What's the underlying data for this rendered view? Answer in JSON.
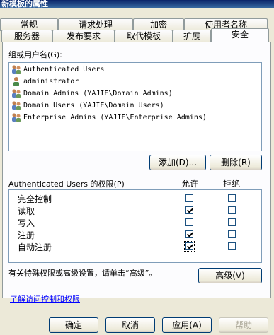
{
  "window": {
    "title": "新模板的属性"
  },
  "tabs_row1": [
    {
      "label": "常规"
    },
    {
      "label": "请求处理"
    },
    {
      "label": "加密"
    },
    {
      "label": "使用者名称"
    }
  ],
  "tabs_row2": [
    {
      "label": "服务器"
    },
    {
      "label": "发布要求"
    },
    {
      "label": "取代模板"
    },
    {
      "label": "扩展"
    },
    {
      "label": "安全"
    }
  ],
  "group": {
    "label": "组或用户名(G):",
    "items": [
      {
        "label": "Authenticated Users",
        "icon": "group-icon"
      },
      {
        "label": "administrator",
        "icon": "user-icon"
      },
      {
        "label": "Domain Admins (YAJIE\\Domain Admins)",
        "icon": "group-icon"
      },
      {
        "label": "Domain Users (YAJIE\\Domain Users)",
        "icon": "group-icon"
      },
      {
        "label": "Enterprise Admins (YAJIE\\Enterprise Admins)",
        "icon": "group-icon"
      }
    ],
    "add_label": "添加(D)...",
    "remove_label": "删除(R)"
  },
  "permissions": {
    "header": "Authenticated Users 的权限(P)",
    "allow_label": "允许",
    "deny_label": "拒绝",
    "rows": [
      {
        "name": "完全控制",
        "allow": false,
        "deny": false
      },
      {
        "name": "读取",
        "allow": true,
        "deny": false
      },
      {
        "name": "写入",
        "allow": false,
        "deny": false
      },
      {
        "name": "注册",
        "allow": true,
        "deny": false
      },
      {
        "name": "自动注册",
        "allow": true,
        "deny": false
      }
    ]
  },
  "advanced": {
    "text": "有关特殊权限或高级设置，请单击“高级”。",
    "button": "高级(V)"
  },
  "learn_link": "了解访问控制和权限",
  "footer": {
    "ok": "确定",
    "cancel": "取消",
    "apply": "应用(A)",
    "help": "帮助"
  }
}
